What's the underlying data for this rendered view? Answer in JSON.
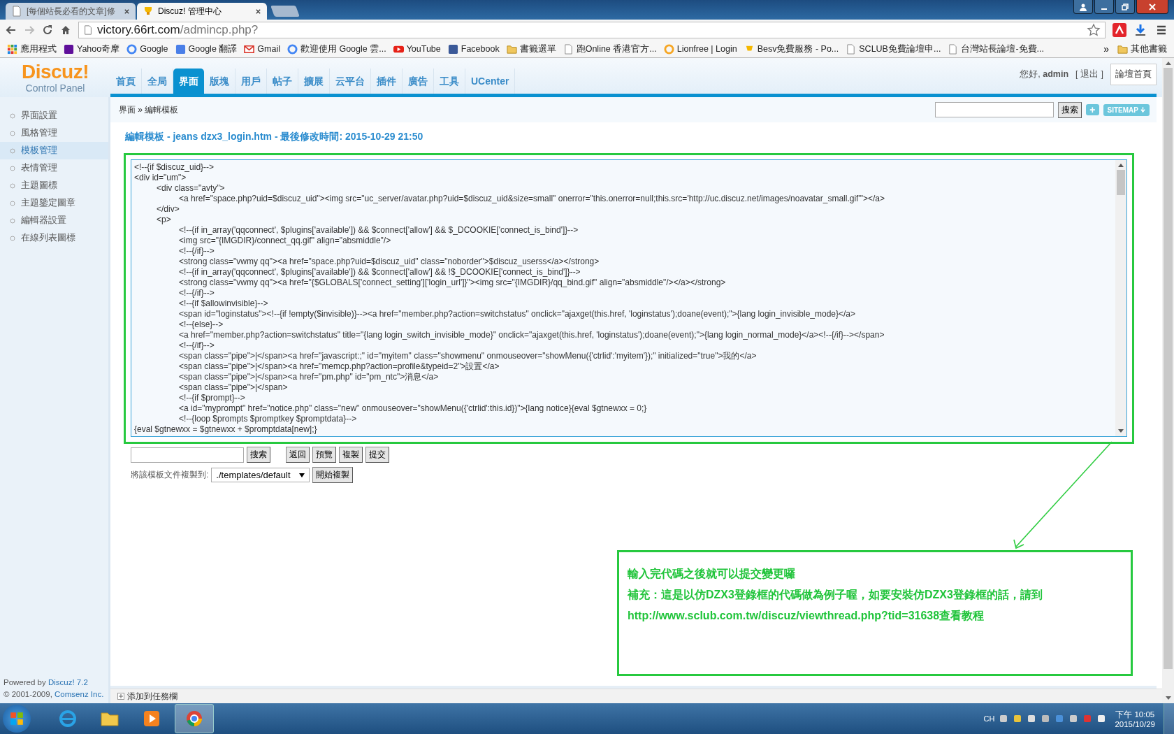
{
  "browser": {
    "tabs": [
      {
        "title": "[每個站長必看的文章]修",
        "selected": false
      },
      {
        "title": "Discuz! 管理中心",
        "selected": true
      }
    ],
    "url_host": "victory.66rt.com",
    "url_path": "/admincp.php?",
    "bookmarks": [
      {
        "label": "應用程式",
        "kind": "apps"
      },
      {
        "label": "Yahoo奇摩",
        "kind": "yahoo"
      },
      {
        "label": "Google",
        "kind": "google"
      },
      {
        "label": "Google 翻譯",
        "kind": "translate"
      },
      {
        "label": "Gmail",
        "kind": "gmail"
      },
      {
        "label": "歡迎使用 Google 雲...",
        "kind": "google"
      },
      {
        "label": "YouTube",
        "kind": "youtube"
      },
      {
        "label": "Facebook",
        "kind": "facebook"
      },
      {
        "label": "書籤選單",
        "kind": "folder"
      },
      {
        "label": "跑Online 香港官方...",
        "kind": "page"
      },
      {
        "label": "Lionfree | Login",
        "kind": "lion"
      },
      {
        "label": "Besv免費服務 - Po...",
        "kind": "besv"
      },
      {
        "label": "SCLUB免費論壇申...",
        "kind": "page"
      },
      {
        "label": "台灣站長論壇-免費...",
        "kind": "page"
      }
    ],
    "more": "»",
    "other_bookmarks": "其他書籤"
  },
  "header": {
    "logo": "Discuz!",
    "logo_sub": "Control Panel",
    "nav": [
      {
        "label": "首頁",
        "selected": false
      },
      {
        "label": "全局",
        "selected": false
      },
      {
        "label": "界面",
        "selected": true
      },
      {
        "label": "版塊",
        "selected": false
      },
      {
        "label": "用戶",
        "selected": false
      },
      {
        "label": "帖子",
        "selected": false
      },
      {
        "label": "擴展",
        "selected": false
      },
      {
        "label": "云平台",
        "selected": false
      },
      {
        "label": "插件",
        "selected": false
      },
      {
        "label": "廣告",
        "selected": false
      },
      {
        "label": "工具",
        "selected": false
      },
      {
        "label": "UCenter",
        "selected": false
      }
    ],
    "greeting": "您好, **admin**",
    "logout": "[ 退出 ]",
    "forum_home": "論壇首頁"
  },
  "breadcrumb": "界面 » 編輯模板",
  "search_button": "搜索",
  "add_button": "+",
  "sitemap_button": "SITEMAP",
  "sidebar": [
    {
      "label": "界面設置",
      "selected": false
    },
    {
      "label": "風格管理",
      "selected": false
    },
    {
      "label": "模板管理",
      "selected": true
    },
    {
      "label": "表情管理",
      "selected": false
    },
    {
      "label": "主題圖標",
      "selected": false
    },
    {
      "label": "主題鑒定圖章",
      "selected": false
    },
    {
      "label": "編輯器設置",
      "selected": false
    },
    {
      "label": "在線列表圖標",
      "selected": false
    }
  ],
  "editor": {
    "title": "編輯模板 - jeans dzx3_login.htm - 最後修改時間: 2015-10-29 21:50",
    "code_lines": [
      "<!--{if $discuz_uid}-->",
      "<div id=\"um\">",
      "\t<div class=\"avty\">",
      "\t\t<a href=\"space.php?uid=$discuz_uid\"><img src=\"uc_server/avatar.php?uid=$discuz_uid&size=small\" onerror=\"this.onerror=null;this.src='http://uc.discuz.net/images/noavatar_small.gif'\"></a>",
      "\t</div>",
      "\t<p>",
      "\t\t<!--{if in_array('qqconnect', $plugins['available']) && $connect['allow'] && $_DCOOKIE['connect_is_bind']}-->",
      "\t\t<img src=\"{IMGDIR}/connect_qq.gif\" align=\"absmiddle\"/>",
      "\t\t<!--{/if}-->",
      "\t\t<strong class=\"vwmy qq\"><a href=\"space.php?uid=$discuz_uid\" class=\"noborder\">$discuz_userss</a></strong>",
      "\t\t<!--{if in_array('qqconnect', $plugins['available']) && $connect['allow'] && !$_DCOOKIE['connect_is_bind']}-->",
      "\t\t<strong class=\"vwmy qq\"><a href=\"{$GLOBALS['connect_setting']['login_url']}\"><img src=\"{IMGDIR}/qq_bind.gif\" align=\"absmiddle\"/></a></strong>",
      "\t\t<!--{/if}-->",
      "\t\t<!--{if $allowinvisible}-->",
      "\t\t<span id=\"loginstatus\"><!--{if !empty($invisible)}--><a href=\"member.php?action=switchstatus\" onclick=\"ajaxget(this.href, 'loginstatus');doane(event);\">{lang login_invisible_mode}</a>",
      "\t\t<!--{else}-->",
      "\t\t<a href=\"member.php?action=switchstatus\" title=\"{lang login_switch_invisible_mode}\" onclick=\"ajaxget(this.href, 'loginstatus');doane(event);\">{lang login_normal_mode}</a><!--{/if}--></span>",
      "\t\t<!--{/if}-->",
      "\t\t<span class=\"pipe\">|</span><a href=\"javascript:;\" id=\"myitem\" class=\"showmenu\" onmouseover=\"showMenu({'ctrlid':'myitem'});\" initialized=\"true\">我的</a>",
      "\t\t<span class=\"pipe\">|</span><a href=\"memcp.php?action=profile&typeid=2\">設置</a>",
      "\t\t<span class=\"pipe\">|</span><a href=\"pm.php\" id=\"pm_ntc\">消息</a>",
      "\t\t<span class=\"pipe\">|</span>",
      "\t\t<!--{if $prompt}-->",
      "\t\t<a id=\"myprompt\" href=\"notice.php\" class=\"new\" onmouseover=\"showMenu({'ctrlid':this.id})\">{lang notice}{eval $gtnewxx = 0;}",
      "\t\t<!--{loop $prompts $promptkey $promptdata}-->",
      "{eval $gtnewxx = $gtnewxx + $promptdata[new];}"
    ],
    "search_button": "搜索",
    "buttons": [
      "返回",
      "預覽",
      "複製",
      "提交"
    ],
    "copy_label": "將該模板文件複製到:",
    "copy_target": "./templates/default",
    "copy_button": "開始複製"
  },
  "annotation": [
    "輸入完代碼之後就可以提交變更囉",
    "補充：這是以仿DZX3登錄框的代碼做為例子喔，如要安裝仿DZX3登錄框的話，請到",
    "http://www.sclub.com.tw/discuz/viewthread.php?tid=31638查看教程"
  ],
  "footer": {
    "powered": "Powered by",
    "powered_link": "Discuz! 7.2",
    "copyright": "© 2001-2009,",
    "company": "Comsenz Inc.",
    "add_taskbar": "添加到任務欄"
  },
  "taskbar": {
    "apps": [
      {
        "kind": "ie",
        "selected": false
      },
      {
        "kind": "explorer",
        "selected": false
      },
      {
        "kind": "media",
        "selected": false
      },
      {
        "kind": "chrome",
        "selected": true
      }
    ],
    "lang": "CH",
    "time": "下午 10:05",
    "date": "2015/10/29"
  }
}
